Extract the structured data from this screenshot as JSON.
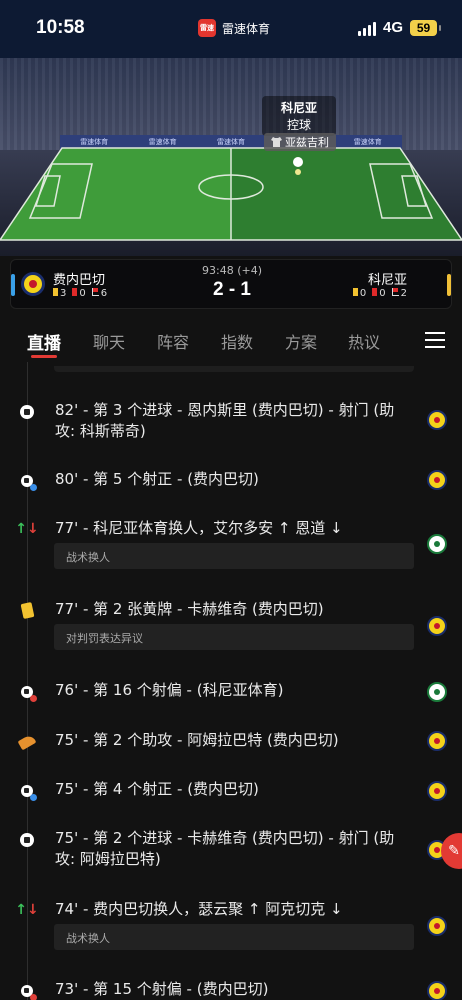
{
  "status_bar": {
    "time": "10:58",
    "network": "4G",
    "battery": "59",
    "app_name": "雷速体育",
    "app_logo_text": "雷速"
  },
  "pitch": {
    "possession_team": "科尼亚",
    "possession_state": "控球",
    "possession_player": "亚兹吉利",
    "board_text": "雷速体育"
  },
  "match": {
    "clock": "93:48 (+4)",
    "score": "2 - 1",
    "home": {
      "name": "费内巴切",
      "yellow": "3",
      "red": "0",
      "corners": "6"
    },
    "away": {
      "name": "科尼亚",
      "yellow": "0",
      "red": "0",
      "corners": "2"
    }
  },
  "tabs": [
    "直播",
    "聊天",
    "阵容",
    "指数",
    "方案",
    "热议"
  ],
  "events": [
    {
      "type": "goal",
      "text": "82' - 第 3 个进球 - 恩内斯里 (费内巴切) - 射门 (助攻: 科斯蒂奇)",
      "team": "home",
      "note": ""
    },
    {
      "type": "shot-on",
      "text": "80' - 第 5 个射正 - (费内巴切)",
      "team": "home",
      "note": ""
    },
    {
      "type": "sub",
      "text": "77' - 科尼亚体育换人，艾尔多安 ↑ 恩道 ↓",
      "team": "away",
      "note": "战术换人"
    },
    {
      "type": "yellow",
      "text": "77' - 第 2 张黄牌 - 卡赫维奇 (费内巴切)",
      "team": "home",
      "note": "对判罚表达异议"
    },
    {
      "type": "shot-off",
      "text": "76' - 第 16 个射偏 - (科尼亚体育)",
      "team": "away",
      "note": ""
    },
    {
      "type": "assist",
      "text": "75' - 第 2 个助攻 - 阿姆拉巴特 (费内巴切)",
      "team": "home",
      "note": ""
    },
    {
      "type": "shot-on",
      "text": "75' - 第 4 个射正 - (费内巴切)",
      "team": "home",
      "note": ""
    },
    {
      "type": "goal",
      "text": "75' - 第 2 个进球 - 卡赫维奇 (费内巴切) - 射门 (助攻: 阿姆拉巴特)",
      "team": "home",
      "note": ""
    },
    {
      "type": "sub",
      "text": "74' - 费内巴切换人，瑟云聚 ↑ 阿克切克 ↓",
      "team": "home",
      "note": "战术换人"
    },
    {
      "type": "shot-off",
      "text": "73' - 第 15 个射偏 - (费内巴切)",
      "team": "home",
      "note": ""
    }
  ],
  "colors": {
    "accent": "#e23a34",
    "home_primary": "#f4d21a",
    "away_primary": "#1a7a3a"
  }
}
